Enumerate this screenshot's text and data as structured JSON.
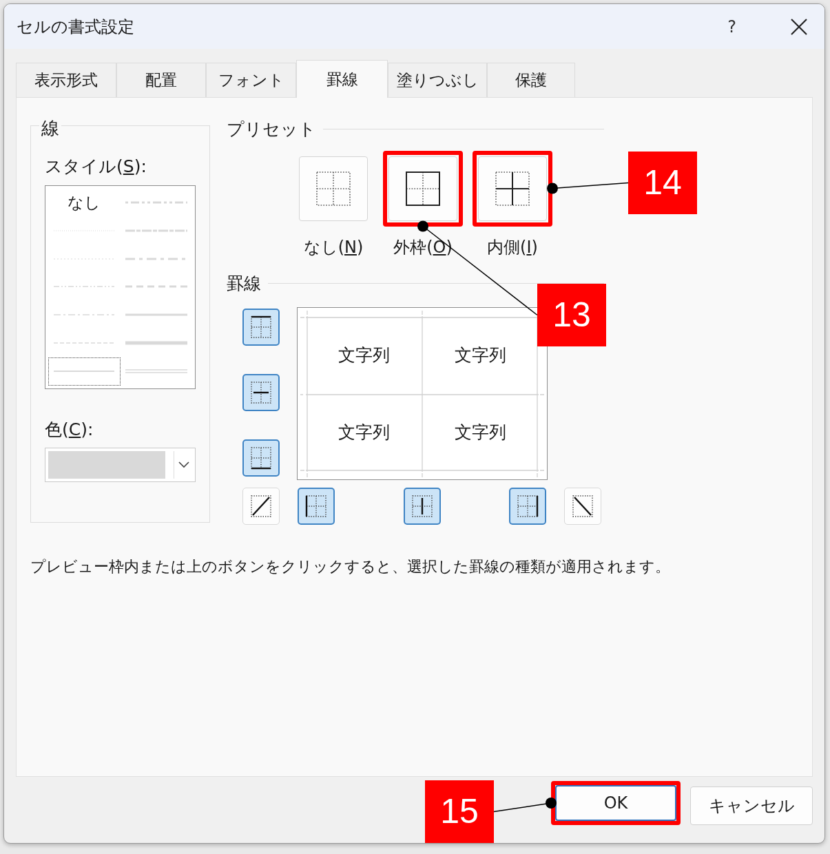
{
  "window": {
    "title": "セルの書式設定",
    "help": "?"
  },
  "tabs": [
    {
      "label": "表示形式",
      "selected": false
    },
    {
      "label": "配置",
      "selected": false
    },
    {
      "label": "フォント",
      "selected": false
    },
    {
      "label": "罫線",
      "selected": true
    },
    {
      "label": "塗りつぶし",
      "selected": false
    },
    {
      "label": "保護",
      "selected": false
    }
  ],
  "line": {
    "legend": "線",
    "style_label": {
      "before": "スタイル(",
      "key": "S",
      "after": "):"
    },
    "styles": [
      {
        "kind": "none",
        "label": "なし",
        "selected": false
      },
      {
        "kind": "medium-dash-dot-dot",
        "selected": false
      },
      {
        "kind": "hair",
        "selected": false
      },
      {
        "kind": "slant-dash-dot",
        "selected": false
      },
      {
        "kind": "dotted",
        "selected": false
      },
      {
        "kind": "medium-dash-dot",
        "selected": false
      },
      {
        "kind": "dash-dot-dot",
        "selected": false
      },
      {
        "kind": "medium-dashed",
        "selected": false
      },
      {
        "kind": "dash-dot",
        "selected": false
      },
      {
        "kind": "medium",
        "selected": false
      },
      {
        "kind": "dashed",
        "selected": false
      },
      {
        "kind": "thick",
        "selected": false
      },
      {
        "kind": "thin",
        "selected": true
      },
      {
        "kind": "double",
        "selected": false
      }
    ],
    "color_label": {
      "before": "色(",
      "key": "C",
      "after": "):"
    },
    "color": "#d9d9d9"
  },
  "presets": {
    "heading": "プリセット",
    "items": [
      {
        "kind": "none",
        "label": {
          "before": "なし(",
          "key": "N",
          "after": ")"
        },
        "highlighted": false
      },
      {
        "kind": "outline",
        "label": {
          "before": "外枠(",
          "key": "O",
          "after": ")"
        },
        "highlighted": true
      },
      {
        "kind": "inside",
        "label": {
          "before": "内側(",
          "key": "I",
          "after": ")"
        },
        "highlighted": true
      }
    ]
  },
  "borders": {
    "heading": "罫線",
    "buttons": [
      {
        "kind": "top",
        "pressed": true
      },
      {
        "kind": "middle-horizontal",
        "pressed": true
      },
      {
        "kind": "bottom",
        "pressed": true
      },
      {
        "kind": "diagonal-up",
        "pressed": false
      },
      {
        "kind": "left",
        "pressed": true
      },
      {
        "kind": "middle-vertical",
        "pressed": true
      },
      {
        "kind": "right",
        "pressed": true
      },
      {
        "kind": "diagonal-down",
        "pressed": false
      }
    ],
    "preview": [
      "文字列",
      "文字列",
      "文字列",
      "文字列"
    ]
  },
  "description": "プレビュー枠内または上のボタンをクリックすると、選択した罫線の種類が適用されます。",
  "buttons": [
    {
      "label": "OK",
      "default": true,
      "highlighted": true
    },
    {
      "label": "キャンセル",
      "default": false,
      "highlighted": false
    }
  ],
  "callouts": [
    {
      "label": "14"
    },
    {
      "label": "13"
    },
    {
      "label": "15"
    }
  ]
}
